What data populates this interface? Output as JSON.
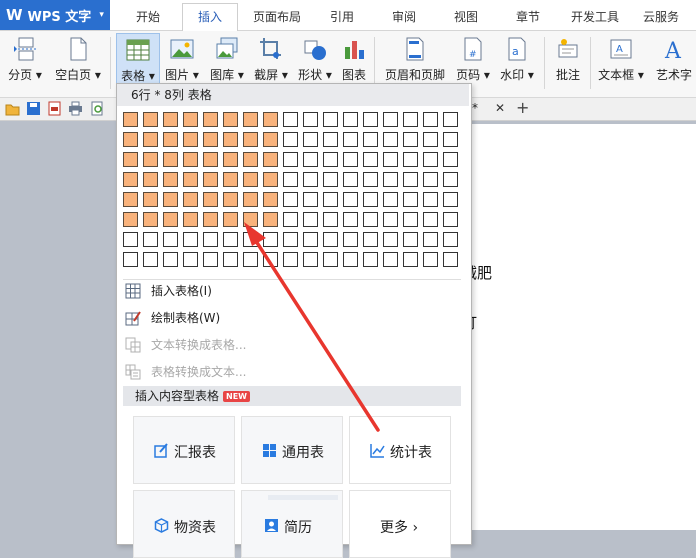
{
  "app": {
    "logo": "W",
    "name": "WPS 文字",
    "menu_arrow": "▾"
  },
  "menu_tabs": [
    "开始",
    "插入",
    "页面布局",
    "引用",
    "审阅",
    "视图",
    "章节",
    "开发工具",
    "云服务"
  ],
  "active_tab": "插入",
  "ribbon": {
    "page_break": "分页 ▾",
    "blank_page": "空白页 ▾",
    "table": "表格 ▾",
    "picture": "图片 ▾",
    "gallery": "图库 ▾",
    "screenshot": "截屏 ▾",
    "shape": "形状 ▾",
    "chart": "图表",
    "header_footer": "页眉和页脚",
    "page_number": "页码 ▾",
    "watermark": "水印 ▾",
    "comment": "批注",
    "textbox": "文本框 ▾",
    "wordart": "艺术字"
  },
  "document": {
    "tab_suffix": "* ",
    "close_glyph": "✕",
    "new_tab_glyph": "+",
    "line1": "减肥",
    "line2": "打"
  },
  "table_picker": {
    "title": "6行 * 8列 表格",
    "rows": 8,
    "cols": 17,
    "selected_rows": 6,
    "selected_cols": 8
  },
  "table_menu": {
    "insert_table": "插入表格(I)",
    "draw_table": "绘制表格(W)",
    "text_to_table": "文本转换成表格...",
    "table_to_text": "表格转换成文本...",
    "content_tables_header": "插入内容型表格",
    "new_badge": "NEW",
    "cards": [
      "汇报表",
      "通用表",
      "统计表",
      "物资表",
      "简历",
      "更多 ›"
    ]
  },
  "colors": {
    "app_blue": "#2a6fcf",
    "selected_cell": "#f9b37c",
    "arrow_red": "#e8362e",
    "card_icon_blue": "#2a7be0"
  }
}
